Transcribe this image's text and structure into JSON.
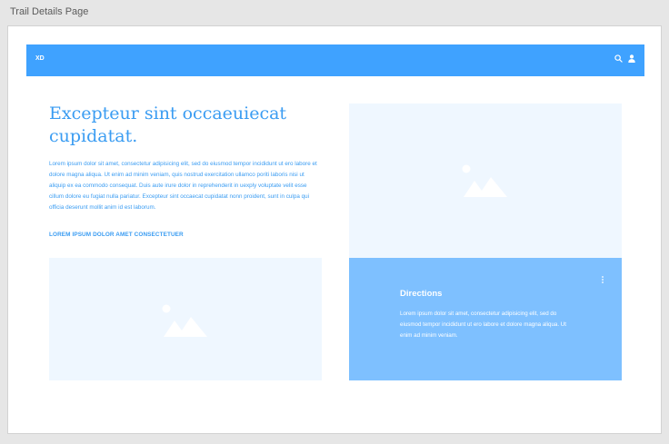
{
  "page_label": "Trail Details Page",
  "navbar": {
    "logo": "XD",
    "icons": [
      "search-icon",
      "user-icon"
    ],
    "background": "#3fa2ff"
  },
  "hero": {
    "title": "Excepteur sint occaeuiecat cupidatat.",
    "body": "Lorem ipsum dolor sit amet, consectetur adipisicing elit, sed do eiusmod tempor incididunt ut ero labore et dolore magna aliqua. Ut enim ad minim veniam, quis nostrud exercitation ullamco poriti laboris nisi ut aliquip ex ea commodo consequat. Duis aute irure dolor in reprehenderit in uexply voluptate velit esse cillum dolore eu fugiat nulla pariatur. Excepteur sint occaecat cupidatat nonn proident, sunt in culpa qui officia deserunt mollit anim id est laborum.",
    "link_label": "LOREM IPSUM DOLOR AMET CONSECTETUER"
  },
  "directions": {
    "title": "Directions",
    "body": "Lorem ipsum dolor sit amet, consectetur adipisicing elit, sed do eiusmod tempor incididunt ut ero labore et dolore magna aliqua. Ut enim ad minim veniam.",
    "menu_icon": "more-vertical-icon"
  },
  "colors": {
    "accent": "#3a9cf2",
    "image_placeholder": "#eff7ff",
    "card_background": "#7ec0ff",
    "canvas": "#e6e6e6"
  }
}
